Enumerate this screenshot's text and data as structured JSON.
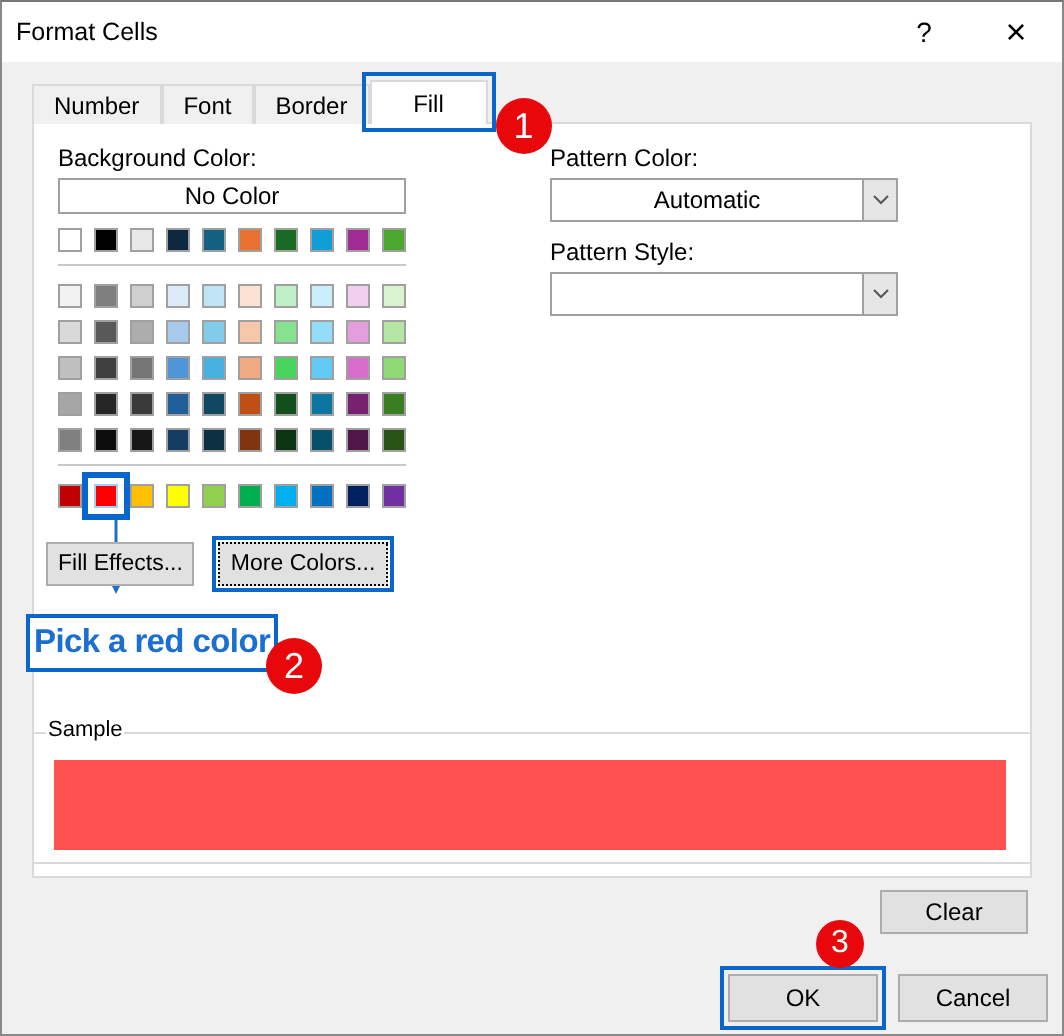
{
  "window": {
    "title": "Format Cells",
    "help": "?",
    "close": "×"
  },
  "tabs": [
    {
      "label": "Number",
      "selected": false,
      "highlighted": false
    },
    {
      "label": "Font",
      "selected": false,
      "highlighted": false
    },
    {
      "label": "Border",
      "selected": false,
      "highlighted": false
    },
    {
      "label": "Fill",
      "selected": true,
      "highlighted": true
    }
  ],
  "background_color": {
    "label": "Background Color:",
    "no_color": "No Color",
    "theme_row": [
      {
        "color": "#ffffff",
        "selected": false
      },
      {
        "color": "#000000",
        "selected": false
      },
      {
        "color": "#e8e8e8",
        "selected": false
      },
      {
        "color": "#0e2841",
        "selected": false
      },
      {
        "color": "#156082",
        "selected": false
      },
      {
        "color": "#e97132",
        "selected": false
      },
      {
        "color": "#196b24",
        "selected": false
      },
      {
        "color": "#0f9ed5",
        "selected": false
      },
      {
        "color": "#a02b93",
        "selected": false
      },
      {
        "color": "#4ea72e",
        "selected": false
      }
    ],
    "shade_rows": [
      [
        {
          "color": "#f2f2f2",
          "selected": false
        },
        {
          "color": "#7f7f7f",
          "selected": false
        },
        {
          "color": "#d0d0d0",
          "selected": false
        },
        {
          "color": "#dceaf7",
          "selected": false
        },
        {
          "color": "#c1e4f5",
          "selected": false
        },
        {
          "color": "#fbe2d5",
          "selected": false
        },
        {
          "color": "#c0f0c8",
          "selected": false
        },
        {
          "color": "#caedfb",
          "selected": false
        },
        {
          "color": "#f2cfee",
          "selected": false
        },
        {
          "color": "#daf2d0",
          "selected": false
        }
      ],
      [
        {
          "color": "#d9d9d9",
          "selected": false
        },
        {
          "color": "#595959",
          "selected": false
        },
        {
          "color": "#adadad",
          "selected": false
        },
        {
          "color": "#a6caec",
          "selected": false
        },
        {
          "color": "#83cbeb",
          "selected": false
        },
        {
          "color": "#f7c7ac",
          "selected": false
        },
        {
          "color": "#84e291",
          "selected": false
        },
        {
          "color": "#95dcf7",
          "selected": false
        },
        {
          "color": "#e59edd",
          "selected": false
        },
        {
          "color": "#b4e5a2",
          "selected": false
        }
      ],
      [
        {
          "color": "#bfbfbf",
          "selected": false
        },
        {
          "color": "#404040",
          "selected": false
        },
        {
          "color": "#757575",
          "selected": false
        },
        {
          "color": "#4e95d9",
          "selected": false
        },
        {
          "color": "#45b0e1",
          "selected": false
        },
        {
          "color": "#f2aa84",
          "selected": false
        },
        {
          "color": "#47d45a",
          "selected": false
        },
        {
          "color": "#61cbf3",
          "selected": false
        },
        {
          "color": "#d86dcd",
          "selected": false
        },
        {
          "color": "#8ed973",
          "selected": false
        }
      ],
      [
        {
          "color": "#a6a6a6",
          "selected": false
        },
        {
          "color": "#262626",
          "selected": false
        },
        {
          "color": "#3a3a3a",
          "selected": false
        },
        {
          "color": "#215f9a",
          "selected": false
        },
        {
          "color": "#104862",
          "selected": false
        },
        {
          "color": "#c04f15",
          "selected": false
        },
        {
          "color": "#124f1a",
          "selected": false
        },
        {
          "color": "#0b76a0",
          "selected": false
        },
        {
          "color": "#782170",
          "selected": false
        },
        {
          "color": "#3b7d23",
          "selected": false
        }
      ],
      [
        {
          "color": "#808080",
          "selected": false
        },
        {
          "color": "#0d0d0d",
          "selected": false
        },
        {
          "color": "#171717",
          "selected": false
        },
        {
          "color": "#153d64",
          "selected": false
        },
        {
          "color": "#0b3041",
          "selected": false
        },
        {
          "color": "#813410",
          "selected": false
        },
        {
          "color": "#0b3512",
          "selected": false
        },
        {
          "color": "#074f6a",
          "selected": false
        },
        {
          "color": "#501549",
          "selected": false
        },
        {
          "color": "#275317",
          "selected": false
        }
      ]
    ],
    "standard_row": [
      {
        "color": "#c00000",
        "selected": false
      },
      {
        "color": "#ff0000",
        "selected": true
      },
      {
        "color": "#ffc000",
        "selected": false
      },
      {
        "color": "#ffff00",
        "selected": false
      },
      {
        "color": "#92d050",
        "selected": false
      },
      {
        "color": "#00b050",
        "selected": false
      },
      {
        "color": "#00b0f0",
        "selected": false
      },
      {
        "color": "#0070c0",
        "selected": false
      },
      {
        "color": "#002060",
        "selected": false
      },
      {
        "color": "#7030a0",
        "selected": false
      }
    ]
  },
  "fill_buttons": [
    {
      "label": "Fill Effects...",
      "highlighted": false
    },
    {
      "label": "More Colors...",
      "highlighted": true
    }
  ],
  "pattern_color": {
    "label": "Pattern Color:",
    "value": "Automatic"
  },
  "pattern_style": {
    "label": "Pattern Style:"
  },
  "sample": {
    "label": "Sample",
    "color": "#ff5050"
  },
  "clear_button": "Clear",
  "footer_buttons": [
    {
      "label": "OK",
      "highlighted": true
    },
    {
      "label": "Cancel",
      "highlighted": false
    }
  ],
  "annotations": {
    "callout": "Pick a red color",
    "badges": [
      "1",
      "2",
      "3"
    ]
  }
}
